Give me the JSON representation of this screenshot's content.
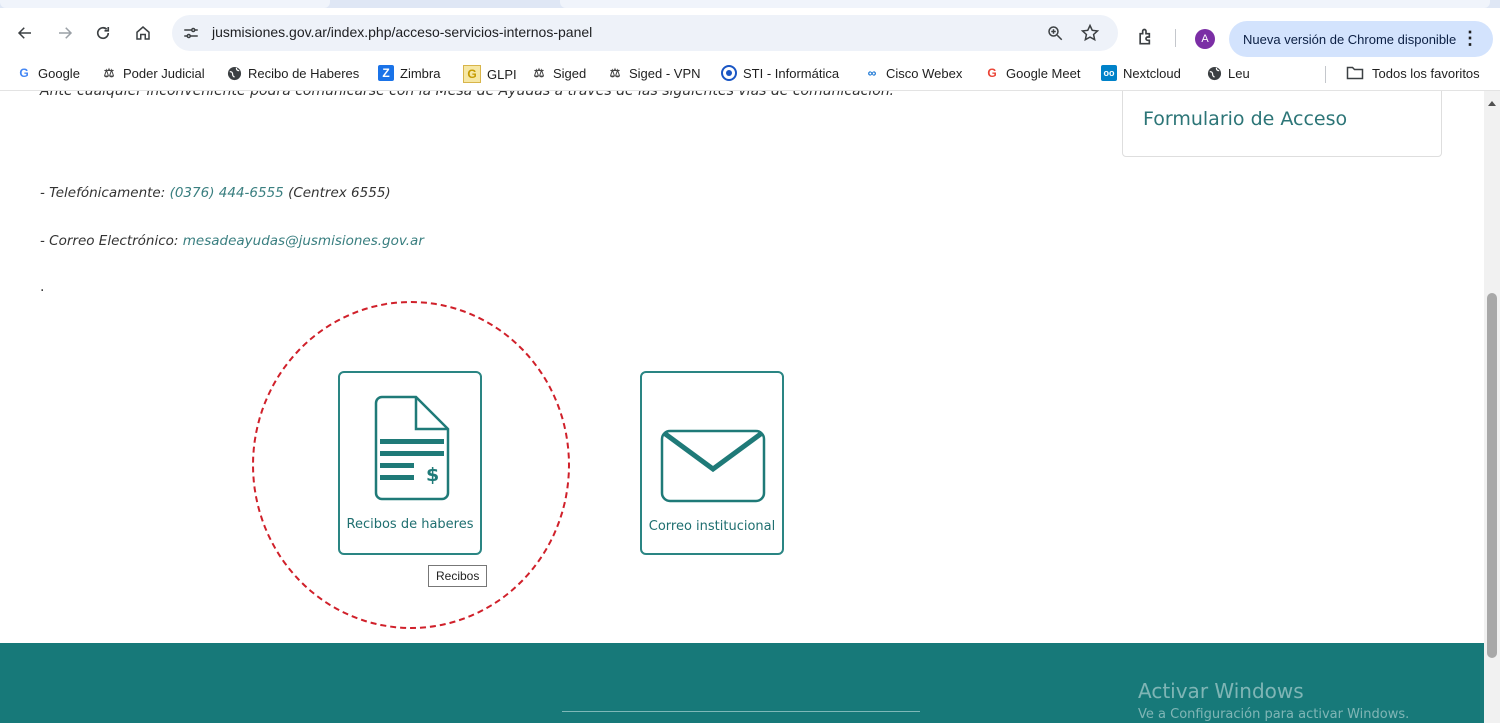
{
  "browser": {
    "url": "jusmisiones.gov.ar/index.php/acceso-servicios-internos-panel",
    "avatar_letter": "A",
    "update_label": "Nueva versión de Chrome disponible",
    "bookmarks": [
      {
        "label": "Google",
        "icon": "google-icon"
      },
      {
        "label": "Poder Judicial",
        "icon": "scales-icon"
      },
      {
        "label": "Recibo de Haberes",
        "icon": "globe-icon"
      },
      {
        "label": "Zimbra",
        "icon": "zimbra-icon"
      },
      {
        "label": "GLPI",
        "icon": "glpi-icon"
      },
      {
        "label": "Siged",
        "icon": "scales-icon"
      },
      {
        "label": "Siged - VPN",
        "icon": "scales-icon"
      },
      {
        "label": "STI - Informática",
        "icon": "sti-icon"
      },
      {
        "label": "Cisco Webex",
        "icon": "webex-icon"
      },
      {
        "label": "Google Meet",
        "icon": "google-icon"
      },
      {
        "label": "Nextcloud",
        "icon": "nextcloud-icon"
      },
      {
        "label": "Leu",
        "icon": "globe-icon"
      }
    ],
    "all_bookmarks_label": "Todos los favoritos"
  },
  "page": {
    "cut_text": "Ante cualquier inconveniente podrá comunicarse con la Mesa de Ayudas a través de las siguientes vías de comunicación:",
    "phone_prefix": "- Telefónicamente: ",
    "phone_link": "(0376) 444-6555",
    "phone_suffix": " (Centrex 6555)",
    "email_prefix": "- Correo Electrónico: ",
    "email_link": "mesadeayudas@jusmisiones.gov.ar",
    "dot": ".",
    "side_card_title": "Formulario de Acceso",
    "tiles": [
      {
        "label": "Recibos de haberes",
        "icon": "receipt-document-icon"
      },
      {
        "label": "Correo institucional",
        "icon": "envelope-icon"
      }
    ],
    "tooltip": "Recibos"
  },
  "watermark": {
    "line1": "Activar Windows",
    "line2": "Ve a Configuración para activar Windows."
  },
  "colors": {
    "teal": "#177979",
    "tile_border": "#2a8583",
    "highlight_circle": "#d0202a"
  }
}
